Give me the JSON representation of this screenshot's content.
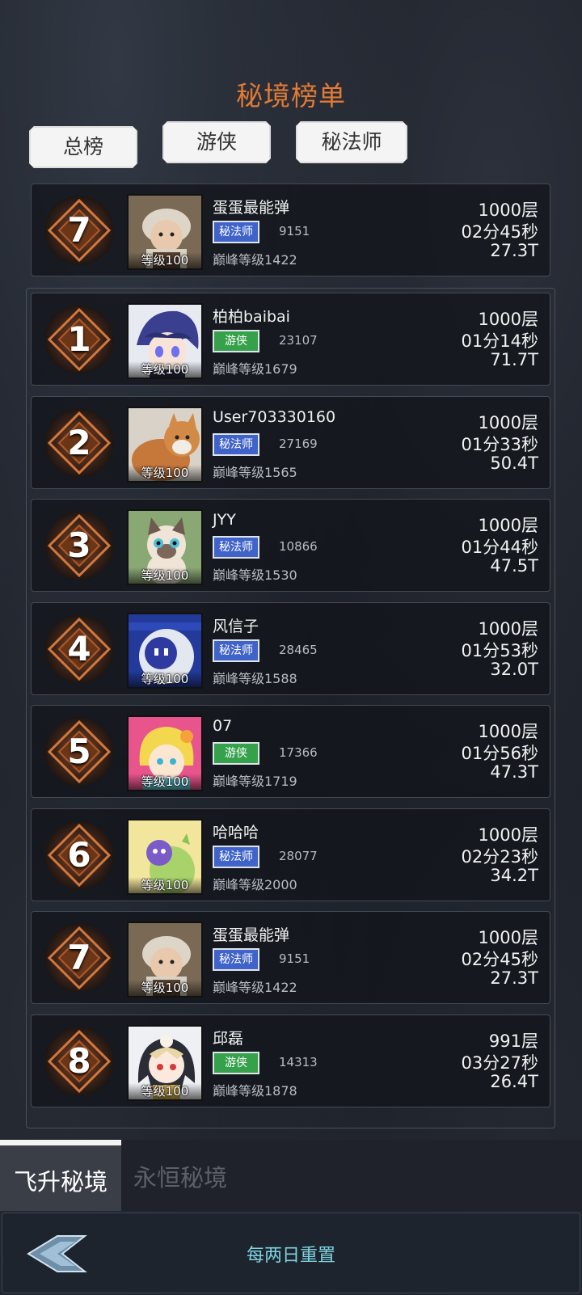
{
  "title": "秘境榜单",
  "filter_tabs": [
    "总榜",
    "游侠",
    "秘法师"
  ],
  "my_entry": {
    "rank": "7",
    "name": "蛋蛋最能弹",
    "class": "秘法师",
    "class_type": "mage",
    "score": "9151",
    "peak": "巅峰等级1422",
    "level": "等级100",
    "floor": "1000层",
    "time": "02分45秒",
    "power": "27.3T",
    "avatar": "baby-photo"
  },
  "entries": [
    {
      "rank": "1",
      "name": "柏柏baibai",
      "class": "游侠",
      "class_type": "ranger",
      "score": "23107",
      "peak": "巅峰等级1679",
      "level": "等级100",
      "floor": "1000层",
      "time": "01分14秒",
      "power": "71.7T",
      "avatar": "anime-boy"
    },
    {
      "rank": "2",
      "name": "User703330160",
      "class": "秘法师",
      "class_type": "mage",
      "score": "27169",
      "peak": "巅峰等级1565",
      "level": "等级100",
      "floor": "1000层",
      "time": "01分33秒",
      "power": "50.4T",
      "avatar": "orange-cat"
    },
    {
      "rank": "3",
      "name": "JYY",
      "class": "秘法师",
      "class_type": "mage",
      "score": "10866",
      "peak": "巅峰等级1530",
      "level": "等级100",
      "floor": "1000层",
      "time": "01分44秒",
      "power": "47.5T",
      "avatar": "siamese-cat"
    },
    {
      "rank": "4",
      "name": "风信子",
      "class": "秘法师",
      "class_type": "mage",
      "score": "28465",
      "peak": "巅峰等级1588",
      "level": "等级100",
      "floor": "1000层",
      "time": "01分53秒",
      "power": "32.0T",
      "avatar": "robot-ball"
    },
    {
      "rank": "5",
      "name": "07",
      "class": "游侠",
      "class_type": "ranger",
      "score": "17366",
      "peak": "巅峰等级1719",
      "level": "等级100",
      "floor": "1000层",
      "time": "01分56秒",
      "power": "47.3T",
      "avatar": "anime-girl"
    },
    {
      "rank": "6",
      "name": "哈哈哈",
      "class": "秘法师",
      "class_type": "mage",
      "score": "28077",
      "peak": "巅峰等级2000",
      "level": "等级100",
      "floor": "1000层",
      "time": "02分23秒",
      "power": "34.2T",
      "avatar": "green-dino"
    },
    {
      "rank": "7",
      "name": "蛋蛋最能弹",
      "class": "秘法师",
      "class_type": "mage",
      "score": "9151",
      "peak": "巅峰等级1422",
      "level": "等级100",
      "floor": "1000层",
      "time": "02分45秒",
      "power": "27.3T",
      "avatar": "baby-photo"
    },
    {
      "rank": "8",
      "name": "邱磊",
      "class": "游侠",
      "class_type": "ranger",
      "score": "14313",
      "peak": "巅峰等级1878",
      "level": "等级100",
      "floor": "991层",
      "time": "03分27秒",
      "power": "26.4T",
      "avatar": "white-hair-girl"
    }
  ],
  "bottom_tabs": {
    "active": "飞升秘境",
    "other": "永恒秘境"
  },
  "footer": {
    "reset_text": "每两日重置"
  }
}
